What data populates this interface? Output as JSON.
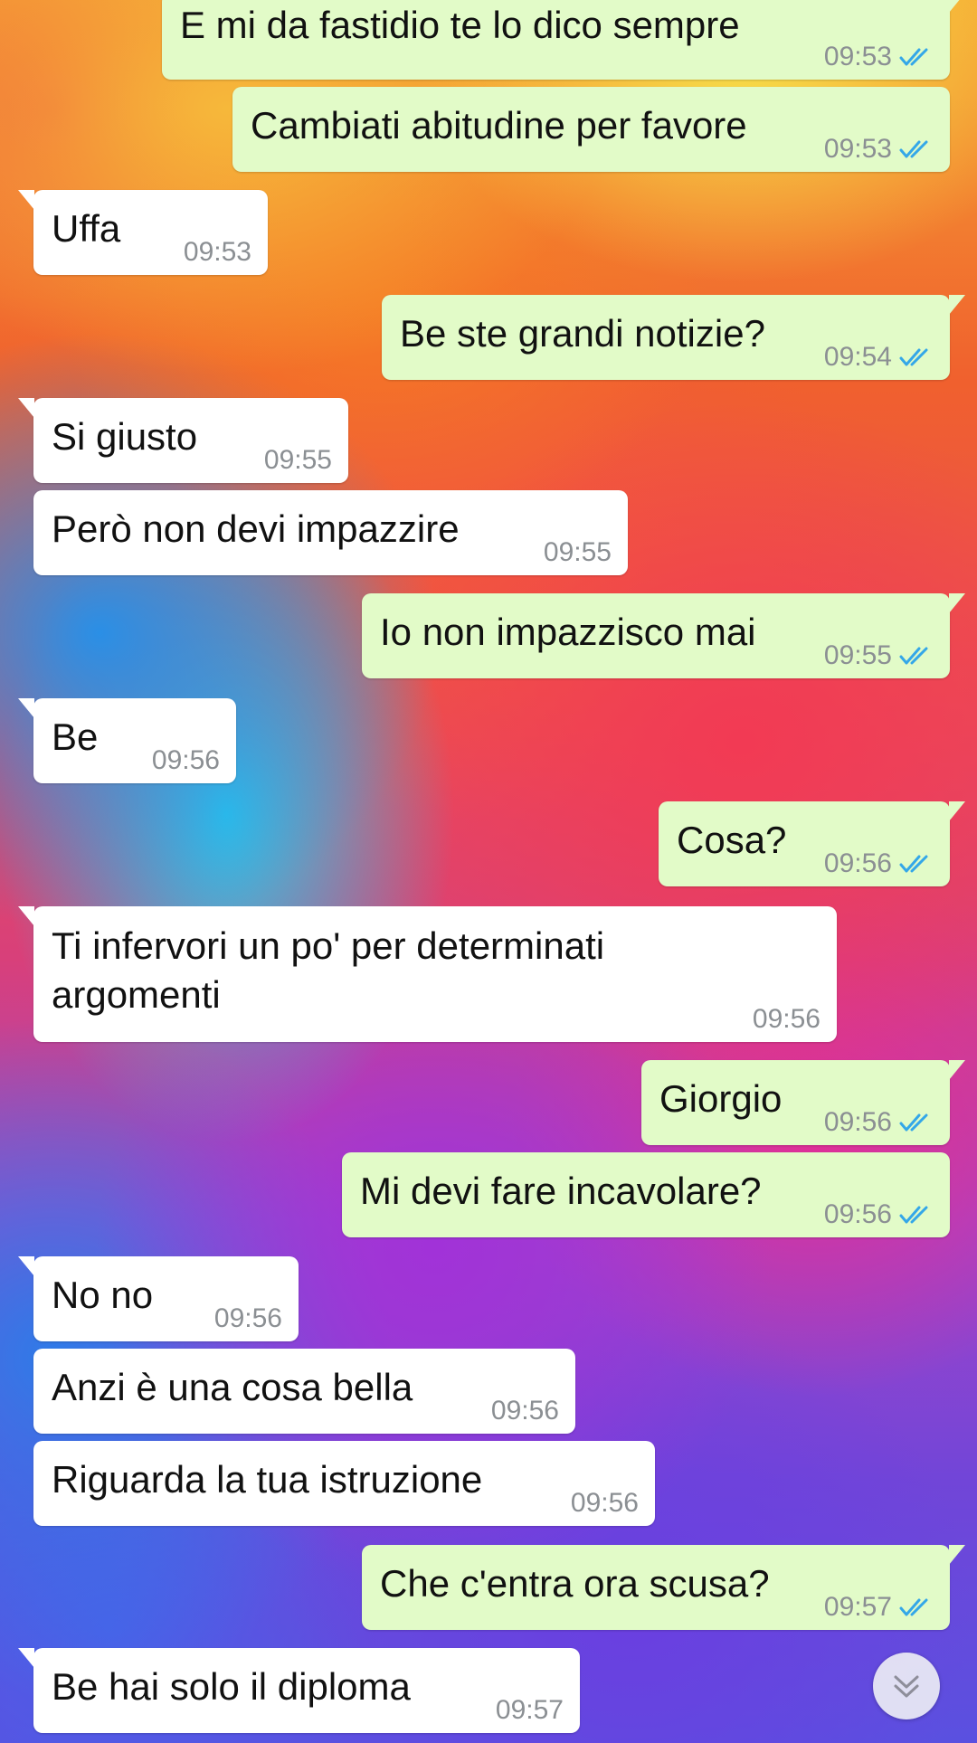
{
  "messages": [
    {
      "dir": "out",
      "text": "E mi da fastidio te lo dico sempre",
      "time": "09:53",
      "status": "read"
    },
    {
      "dir": "out",
      "text": "Cambiati abitudine per favore",
      "time": "09:53",
      "status": "read"
    },
    {
      "dir": "in",
      "text": "Uffa",
      "time": "09:53"
    },
    {
      "dir": "out",
      "text": "Be ste grandi notizie?",
      "time": "09:54",
      "status": "read"
    },
    {
      "dir": "in",
      "text": "Si giusto",
      "time": "09:55"
    },
    {
      "dir": "in",
      "text": "Però non devi impazzire",
      "time": "09:55"
    },
    {
      "dir": "out",
      "text": "Io non impazzisco mai",
      "time": "09:55",
      "status": "read"
    },
    {
      "dir": "in",
      "text": "Be",
      "time": "09:56"
    },
    {
      "dir": "out",
      "text": "Cosa?",
      "time": "09:56",
      "status": "read"
    },
    {
      "dir": "in",
      "text_line1": "Ti infervori un po' per determinati",
      "text_line2": "argomenti",
      "time": "09:56"
    },
    {
      "dir": "out",
      "text": "Giorgio",
      "time": "09:56",
      "status": "read"
    },
    {
      "dir": "out",
      "text": "Mi devi fare incavolare?",
      "time": "09:56",
      "status": "read"
    },
    {
      "dir": "in",
      "text": "No no",
      "time": "09:56"
    },
    {
      "dir": "in",
      "text": "Anzi è una cosa bella",
      "time": "09:56"
    },
    {
      "dir": "in",
      "text": "Riguarda la tua istruzione",
      "time": "09:56"
    },
    {
      "dir": "out",
      "text": "Che c'entra ora scusa?",
      "time": "09:57",
      "status": "read"
    },
    {
      "dir": "in",
      "text": "Be hai solo il diploma",
      "time": "09:57"
    }
  ],
  "colors": {
    "incoming_bubble": "#ffffff",
    "outgoing_bubble": "#e2fbc8",
    "read_ticks": "#34a7e8",
    "timestamp": "#8b8f93"
  },
  "icons": {
    "read_receipt": "double-check-icon",
    "scroll_down": "chevron-double-down-icon"
  }
}
